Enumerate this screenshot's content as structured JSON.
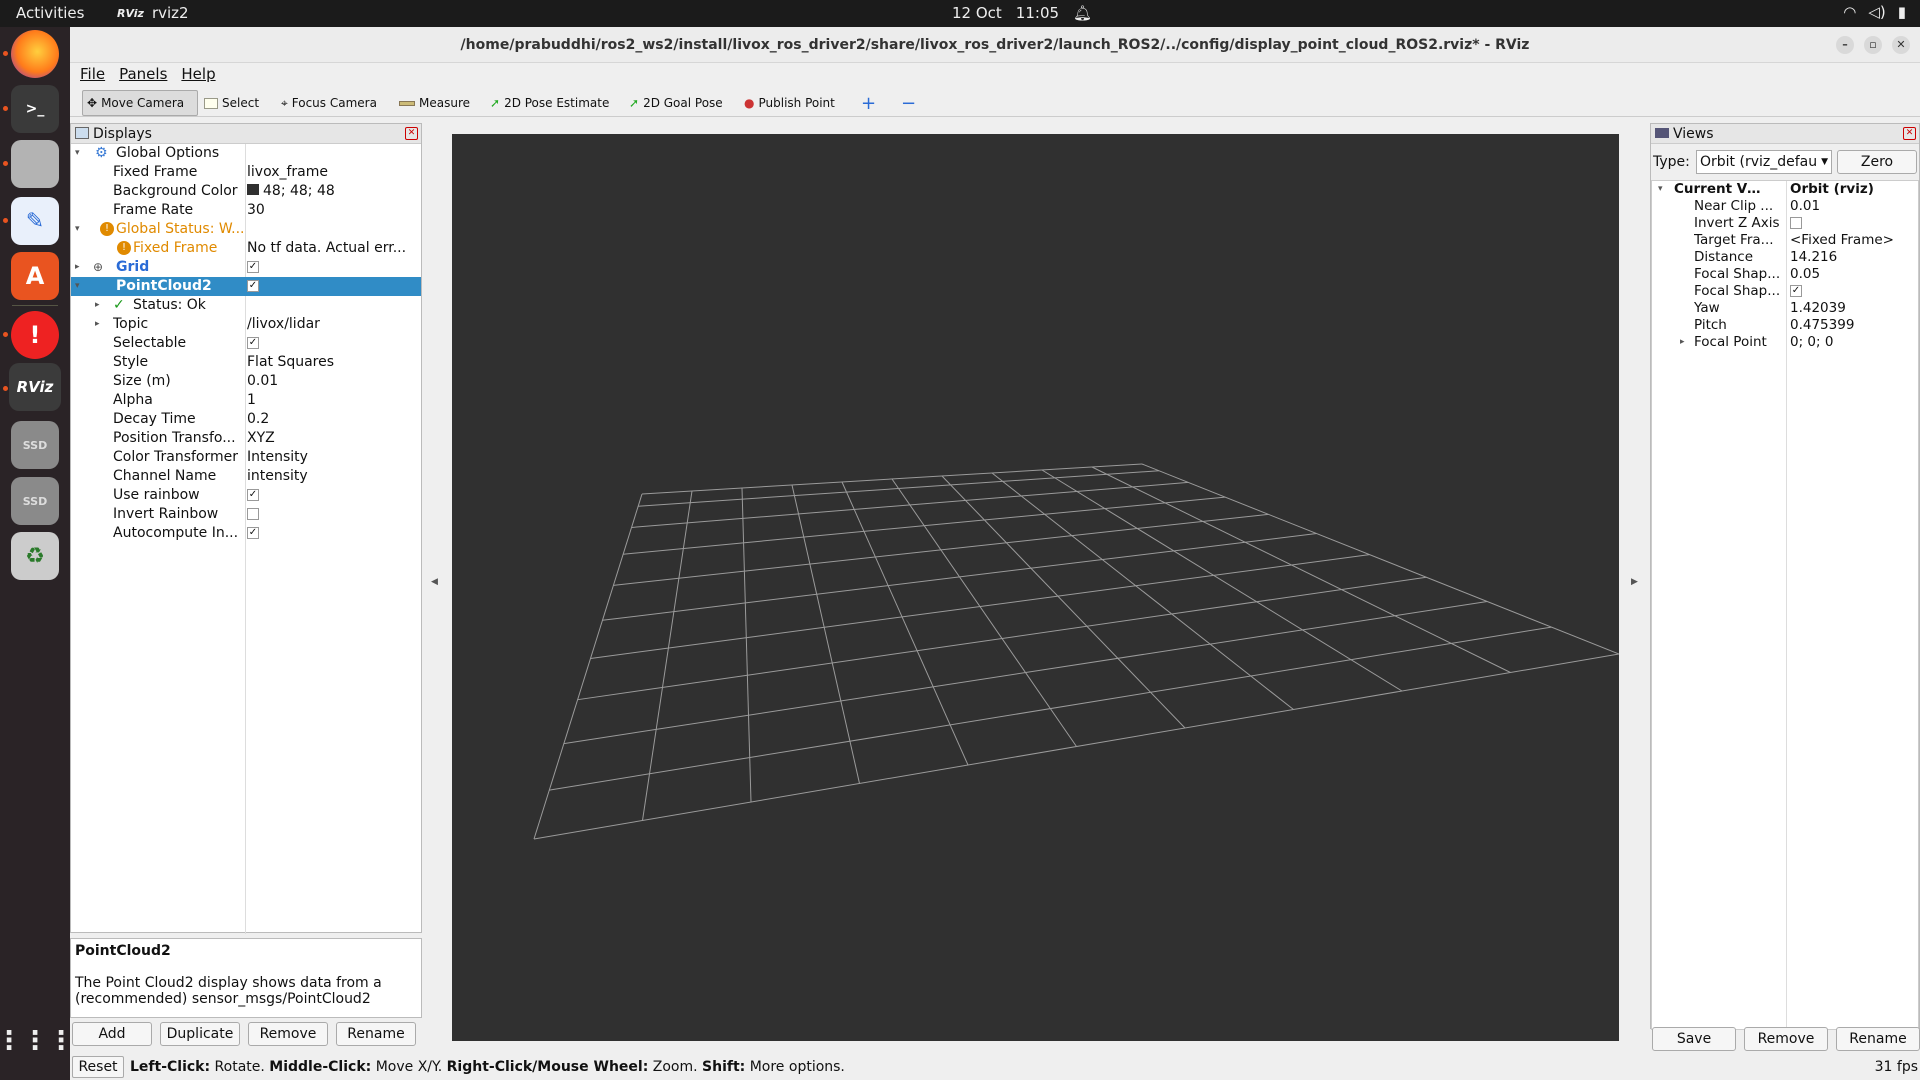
{
  "topbar": {
    "activities": "Activities",
    "app_name": "rviz2",
    "app_logo": "RViz",
    "date": "12 Oct",
    "time": "11:05"
  },
  "window": {
    "title": "/home/prabuddhi/ros2_ws2/install/livox_ros_driver2/share/livox_ros_driver2/launch_ROS2/../config/display_point_cloud_ROS2.rviz* - RViz"
  },
  "menu": [
    "File",
    "Panels",
    "Help"
  ],
  "toolbar": {
    "move_camera": "Move Camera",
    "select": "Select",
    "focus_camera": "Focus Camera",
    "measure": "Measure",
    "pose_estimate": "2D Pose Estimate",
    "goal_pose": "2D Goal Pose",
    "publish_point": "Publish Point",
    "plus": "+",
    "minus": "−"
  },
  "displays": {
    "title": "Displays",
    "rows": [
      {
        "k": "Global Options",
        "v": ""
      },
      {
        "k": "Fixed Frame",
        "v": "livox_frame"
      },
      {
        "k": "Background Color",
        "v": "48; 48; 48"
      },
      {
        "k": "Frame Rate",
        "v": "30"
      },
      {
        "k": "Global Status: W...",
        "v": ""
      },
      {
        "k": "Fixed Frame",
        "v": "No tf data.  Actual err..."
      },
      {
        "k": "Grid",
        "v": ""
      },
      {
        "k": "PointCloud2",
        "v": ""
      },
      {
        "k": "Status: Ok",
        "v": ""
      },
      {
        "k": "Topic",
        "v": "/livox/lidar"
      },
      {
        "k": "Selectable",
        "v": ""
      },
      {
        "k": "Style",
        "v": "Flat Squares"
      },
      {
        "k": "Size (m)",
        "v": "0.01"
      },
      {
        "k": "Alpha",
        "v": "1"
      },
      {
        "k": "Decay Time",
        "v": "0.2"
      },
      {
        "k": "Position Transfo...",
        "v": "XYZ"
      },
      {
        "k": "Color Transformer",
        "v": "Intensity"
      },
      {
        "k": "Channel Name",
        "v": "intensity"
      },
      {
        "k": "Use rainbow",
        "v": ""
      },
      {
        "k": "Invert Rainbow",
        "v": ""
      },
      {
        "k": "Autocompute In...",
        "v": ""
      }
    ],
    "checks": {
      "grid": "✓",
      "pointcloud2": "✓",
      "selectable": "✓",
      "use_rainbow": "✓",
      "invert_rainbow": "",
      "autocompute": "✓"
    },
    "desc_title": "PointCloud2",
    "desc_text": "The Point Cloud2 display shows data from a (recommended) sensor_msgs/PointCloud2",
    "buttons": {
      "add": "Add",
      "duplicate": "Duplicate",
      "remove": "Remove",
      "rename": "Rename"
    }
  },
  "views": {
    "title": "Views",
    "type_label": "Type:",
    "type_value": "Orbit (rviz_defau",
    "zero": "Zero",
    "rows": [
      {
        "k": "Current View",
        "v": "Orbit (rviz)"
      },
      {
        "k": "Near Clip ...",
        "v": "0.01"
      },
      {
        "k": "Invert Z Axis",
        "v": ""
      },
      {
        "k": "Target Fra...",
        "v": "<Fixed Frame>"
      },
      {
        "k": "Distance",
        "v": "14.216"
      },
      {
        "k": "Focal Shap...",
        "v": "0.05"
      },
      {
        "k": "Focal Shap...",
        "v": ""
      },
      {
        "k": "Yaw",
        "v": "1.42039"
      },
      {
        "k": "Pitch",
        "v": "0.475399"
      },
      {
        "k": "Focal Point",
        "v": "0; 0; 0"
      }
    ],
    "focal_check": "✓",
    "buttons": {
      "save": "Save",
      "remove": "Remove",
      "rename": "Rename"
    }
  },
  "status": {
    "reset": "Reset",
    "l1": "Left-Click:",
    "t1": " Rotate. ",
    "l2": "Middle-Click:",
    "t2": " Move X/Y. ",
    "l3": "Right-Click/Mouse Wheel:",
    "t3": " Zoom. ",
    "l4": "Shift:",
    "t4": " More options.",
    "fps": "31 fps"
  },
  "colors": {
    "grid_bg": "#303030",
    "select": "#308cc6",
    "warn": "#e08a00",
    "ok": "#1a9a1a"
  },
  "dock_icons": [
    "firefox-icon",
    "terminal-icon",
    "files-icon",
    "text-editor-icon",
    "app-center-icon",
    "update-icon",
    "rviz-icon",
    "ssd-icon",
    "ssd-icon",
    "trash-icon",
    "app-grid-icon"
  ]
}
